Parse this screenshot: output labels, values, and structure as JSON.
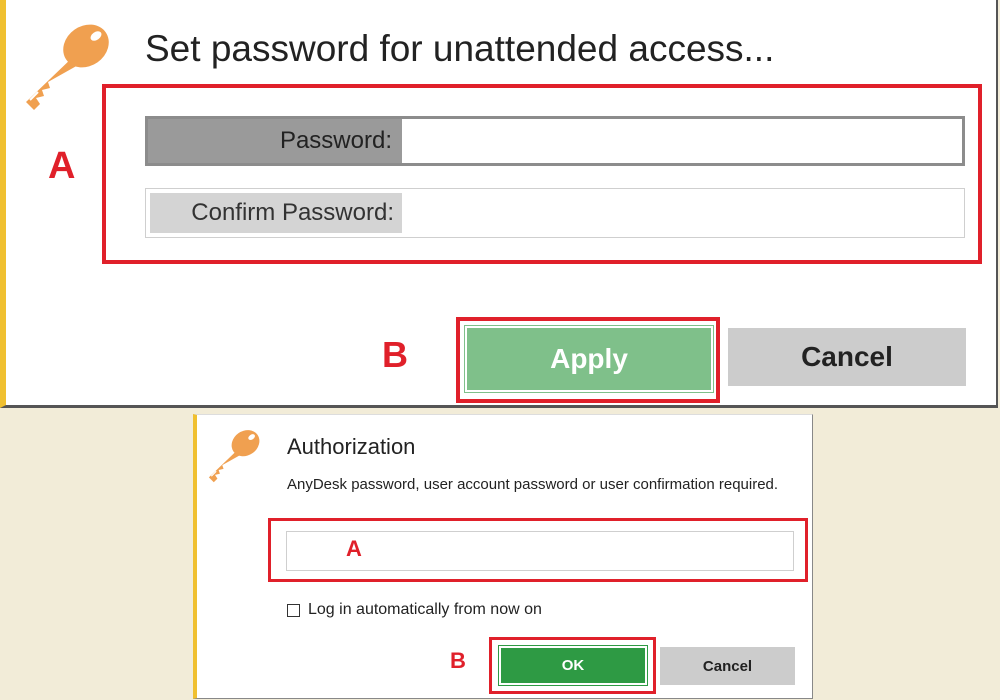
{
  "dialog1": {
    "title": "Set password for unattended access...",
    "password_label": "Password:",
    "password_value": "",
    "confirm_label": "Confirm Password:",
    "confirm_value": "",
    "apply_label": "Apply",
    "cancel_label": "Cancel",
    "marker_a": "A",
    "marker_b": "B",
    "icon": "key-icon"
  },
  "dialog2": {
    "title": "Authorization",
    "message": "AnyDesk password, user account password or user confirmation required.",
    "password_value": "",
    "checkbox_label": "Log in automatically from now on",
    "checkbox_checked": false,
    "ok_label": "OK",
    "cancel_label": "Cancel",
    "marker_a": "A",
    "marker_b": "B",
    "icon": "key-icon"
  },
  "colors": {
    "accent_border": "#f0c030",
    "highlight_red": "#e0202a",
    "apply_green": "#7fc08a",
    "ok_green": "#2e9a44",
    "key_orange": "#f0a050"
  }
}
